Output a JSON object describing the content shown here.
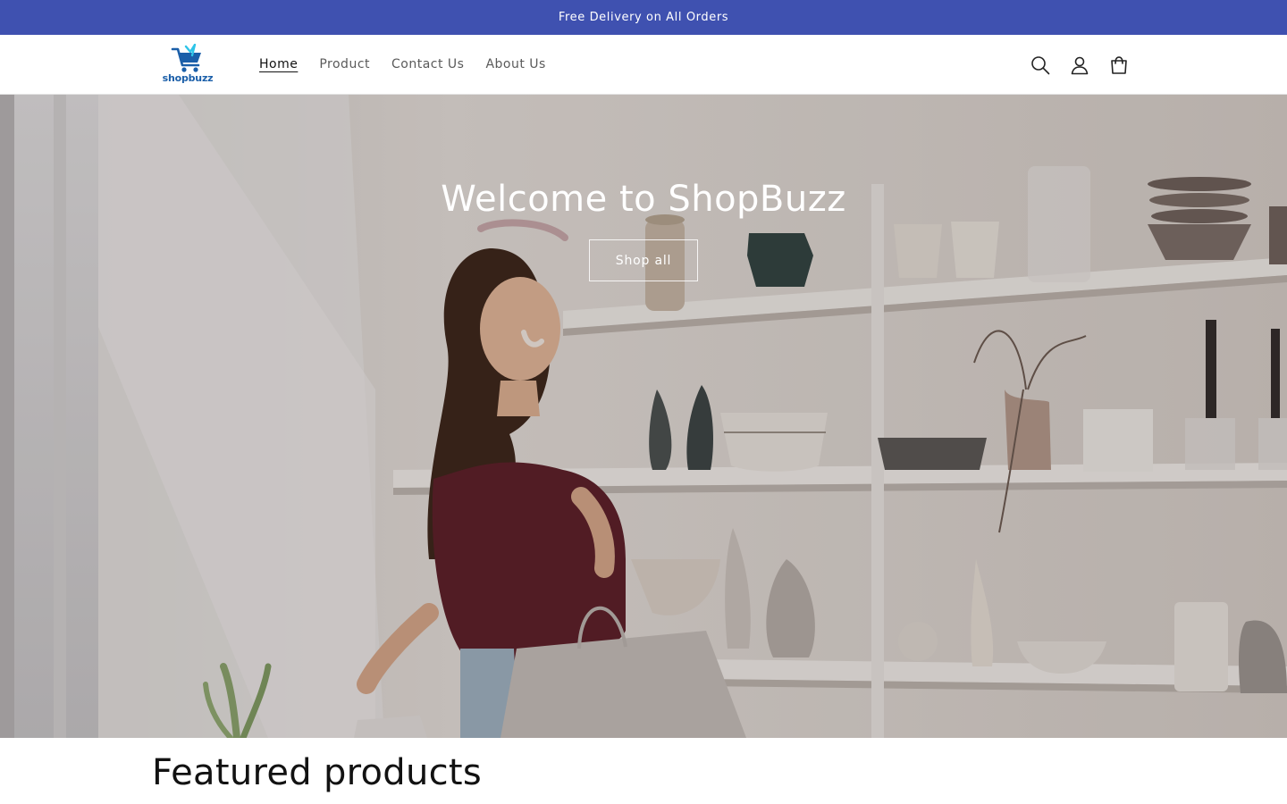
{
  "announcement": {
    "text": "Free Delivery on All Orders"
  },
  "header": {
    "logo_text": "shopbuzz",
    "nav": [
      {
        "label": "Home",
        "active": true
      },
      {
        "label": "Product",
        "active": false
      },
      {
        "label": "Contact Us",
        "active": false
      },
      {
        "label": "About Us",
        "active": false
      }
    ],
    "icons": [
      "search-icon",
      "account-icon",
      "cart-icon"
    ]
  },
  "hero": {
    "title": "Welcome to ShopBuzz",
    "button_label": "Shop all"
  },
  "featured": {
    "heading": "Featured products"
  },
  "colors": {
    "announcement_bg": "#3f51b0",
    "logo_blue": "#1b5fa9",
    "text_primary": "#121212",
    "text_secondary": "#5a5a5a"
  }
}
